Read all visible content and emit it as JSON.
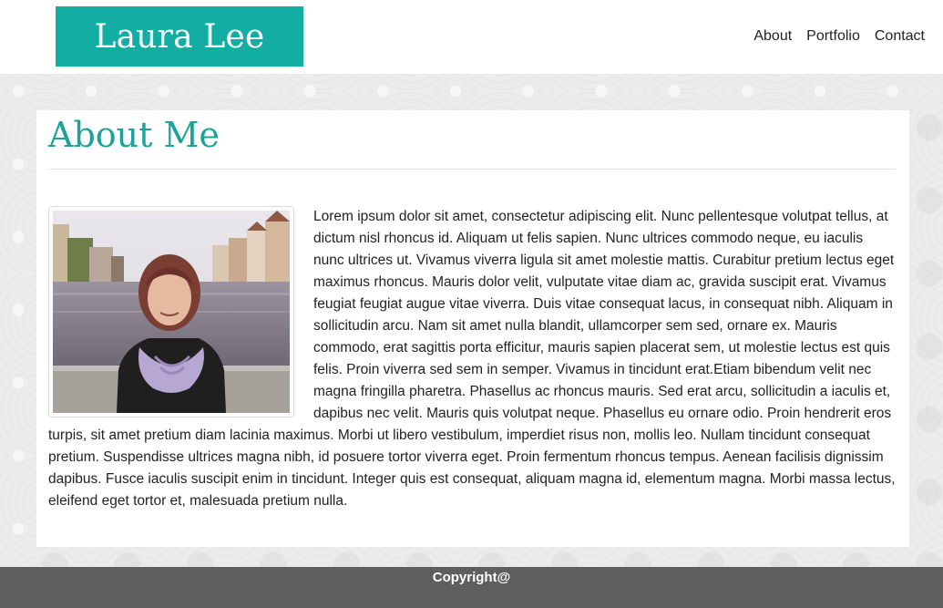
{
  "header": {
    "logo_text": "Laura Lee",
    "nav": [
      {
        "label": "About"
      },
      {
        "label": "Portfolio"
      },
      {
        "label": "Contact"
      }
    ]
  },
  "main": {
    "title": "About Me",
    "body": "Lorem ipsum dolor sit amet, consectetur adipiscing elit. Nunc pellentesque volutpat tellus, at dictum nisl rhoncus id. Aliquam ut felis sapien. Nunc ultrices commodo neque, eu iaculis nunc ultrices ut. Vivamus viverra ligula sit amet molestie mattis. Curabitur pretium lectus eget maximus rhoncus. Mauris dolor velit, vulputate vitae diam ac, gravida suscipit erat. Vivamus feugiat feugiat augue vitae viverra. Duis vitae consequat lacus, in consequat nibh. Aliquam in sollicitudin arcu. Nam sit amet nulla blandit, ullamcorper sem sed, ornare ex. Mauris commodo, erat sagittis porta efficitur, mauris sapien placerat sem, ut molestie lectus est quis felis. Proin viverra sed sem in semper. Vivamus in tincidunt erat.Etiam bibendum velit nec magna fringilla pharetra. Phasellus ac rhoncus mauris. Sed erat arcu, sollicitudin a iaculis et, dapibus nec velit. Mauris quis volutpat neque. Phasellus eu ornare odio. Proin hendrerit eros turpis, sit amet pretium diam lacinia maximus. Morbi ut libero vestibulum, imperdiet risus non, mollis leo. Nullam tincidunt consequat pretium. Suspendisse ultrices magna nibh, id posuere tortor viverra eget. Proin fermentum rhoncus tempus. Aenean facilisis dignissim dapibus. Fusce iaculis suscipit enim in tincidunt. Integer quis est consequat, aliquam magna id, elementum magna. Morbi massa lectus, eleifend eget tortor et, malesuada pretium nulla."
  },
  "footer": {
    "text": "Copyright@"
  },
  "colors": {
    "accent": "#12ada3",
    "title": "#1ba39a",
    "footer_bg": "#5e5e5e"
  }
}
